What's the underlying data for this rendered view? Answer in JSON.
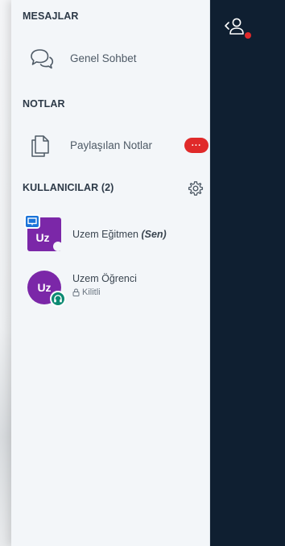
{
  "sections": {
    "messages": "MESAJLAR",
    "notes": "NOTLAR",
    "users": "KULLANICILAR (2)"
  },
  "messages": {
    "public_chat": "Genel Sohbet"
  },
  "notes": {
    "shared_notes": "Paylaşılan Notlar",
    "badge": "···"
  },
  "users": [
    {
      "initials": "Uz",
      "name": "Uzem Eğitmen",
      "you_tag": "(Sen)",
      "role": "presenter",
      "avatar_color": "#7b27a8"
    },
    {
      "initials": "Uz",
      "name": "Uzem Öğrenci",
      "status": "Kilitli",
      "role": "viewer",
      "avatar_color": "#7b27a8"
    }
  ],
  "colors": {
    "accent_red": "#e02a2a",
    "dark_panel": "#0f1f31",
    "presenter_blue": "#1b74d9",
    "headset_green": "#0c8a73"
  },
  "icons": {
    "public_chat": "chat-bubbles-icon",
    "shared_notes": "documents-icon",
    "settings": "gear-icon",
    "toggle_users": "user-list-toggle-icon"
  }
}
